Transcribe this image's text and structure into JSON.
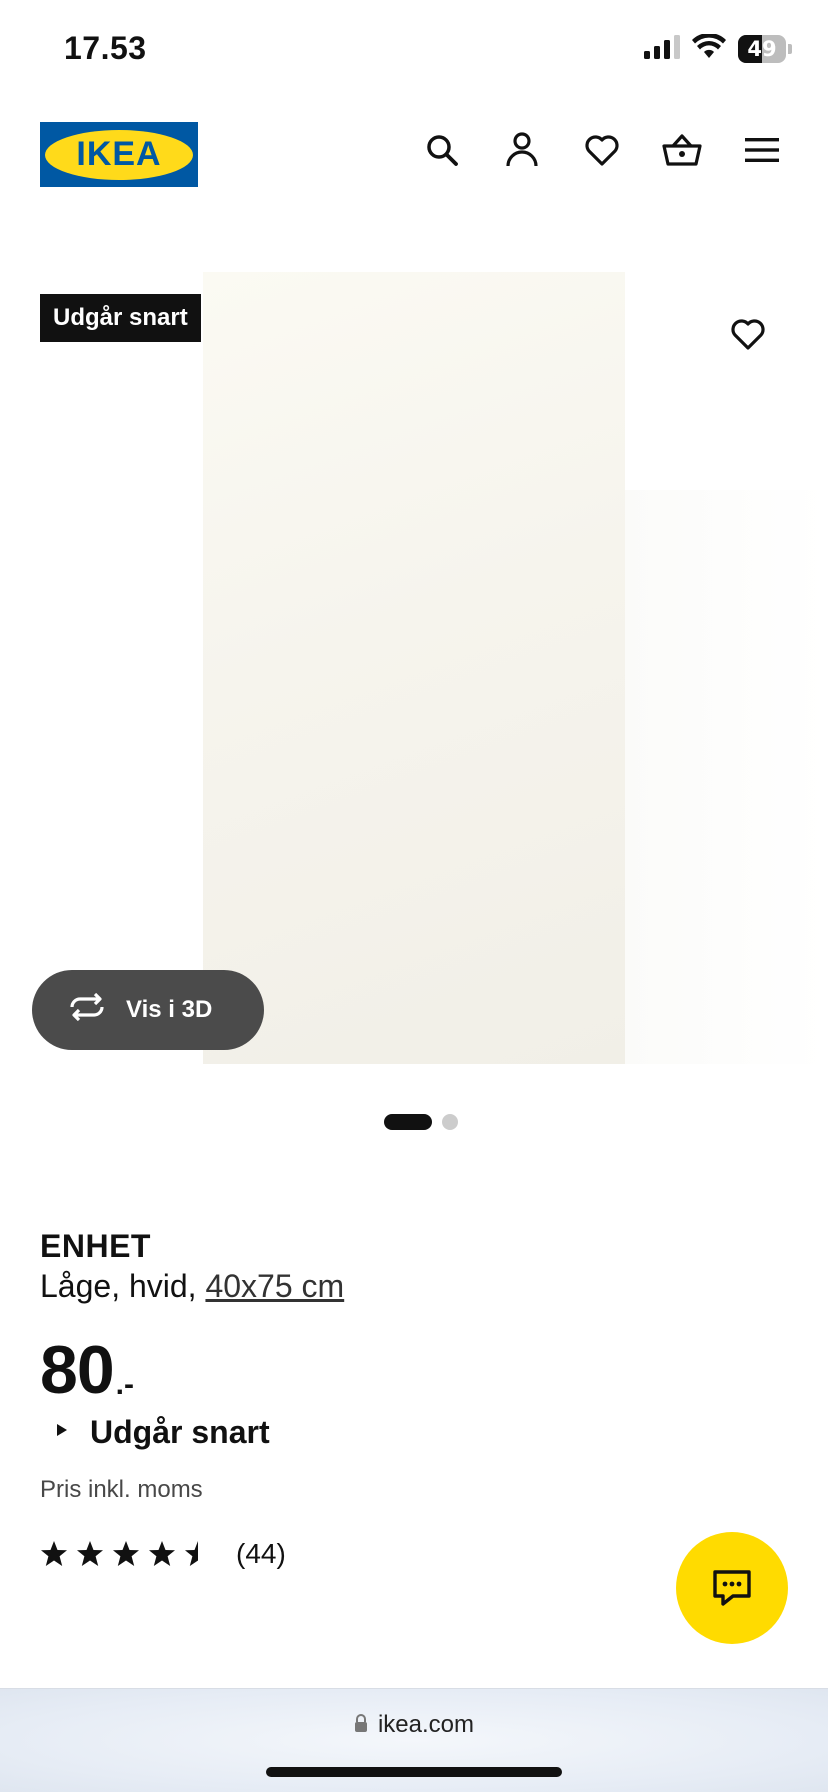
{
  "status_bar": {
    "time": "17.53",
    "battery_level": "49"
  },
  "header": {
    "logo_text": "IKEA",
    "icons": [
      "search-icon",
      "user-icon",
      "heart-icon",
      "basket-icon",
      "menu-icon"
    ]
  },
  "gallery": {
    "badge": "Udgår snart",
    "view_3d_label": "Vis i 3D",
    "image_count": 2,
    "active_index": 0
  },
  "product": {
    "name": "ENHET",
    "desc_prefix": "Låge, hvid,",
    "size": "40x75 cm",
    "price_int": "80",
    "price_suffix": ".-",
    "availability": "Udgår snart",
    "vat_note": "Pris inkl. moms",
    "rating": 4.5,
    "review_count": "(44)"
  },
  "browser": {
    "url": "ikea.com"
  },
  "colors": {
    "ikea_blue": "#0058a3",
    "ikea_yellow": "#ffda1a",
    "chat_yellow": "#ffdb00"
  }
}
